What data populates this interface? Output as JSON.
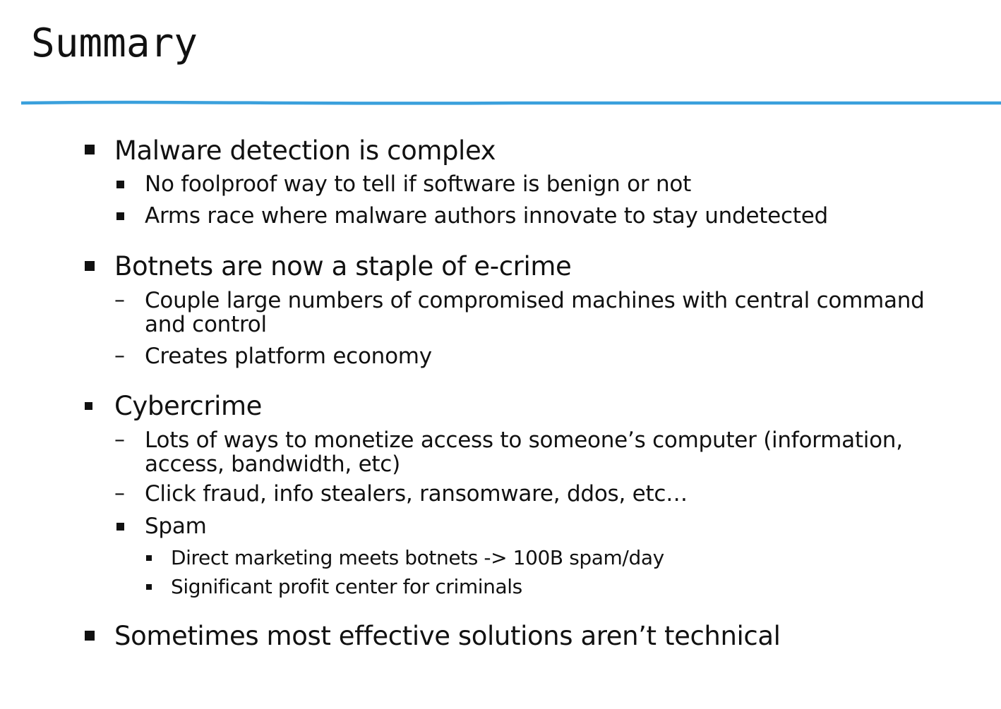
{
  "slide": {
    "title": "Summary",
    "rule_color": "#3aa0dc",
    "items": [
      {
        "text": "Malware detection is complex",
        "bullet": "square",
        "subitems": [
          {
            "text": "No foolproof way to tell if software is benign or not",
            "bullet": "square"
          },
          {
            "text": "Arms race where malware authors innovate to stay undetected",
            "bullet": "square"
          }
        ]
      },
      {
        "text": "Botnets are now a staple of e-crime",
        "bullet": "square",
        "subitems": [
          {
            "text_line1": "Couple large numbers of compromised machines with central command",
            "text_line2": "and control",
            "bullet": "dash"
          },
          {
            "text": "Creates platform economy",
            "bullet": "dash"
          }
        ]
      },
      {
        "text": "Cybercrime",
        "bullet": "square",
        "subitems": [
          {
            "text_line1": "Lots of ways to monetize access to someone’s computer (information,",
            "text_line2": "access, bandwidth, etc)",
            "bullet": "dash"
          },
          {
            "text": "Click fraud, info stealers, ransomware, ddos, etc…",
            "bullet": "dash"
          },
          {
            "text": "Spam",
            "bullet": "square",
            "subitems": [
              {
                "text": "Direct marketing meets botnets -> 100B spam/day",
                "bullet": "square"
              },
              {
                "text": "Significant profit center for criminals",
                "bullet": "square"
              }
            ]
          }
        ]
      },
      {
        "text": "Sometimes most effective solutions aren’t technical",
        "bullet": "square"
      }
    ]
  }
}
